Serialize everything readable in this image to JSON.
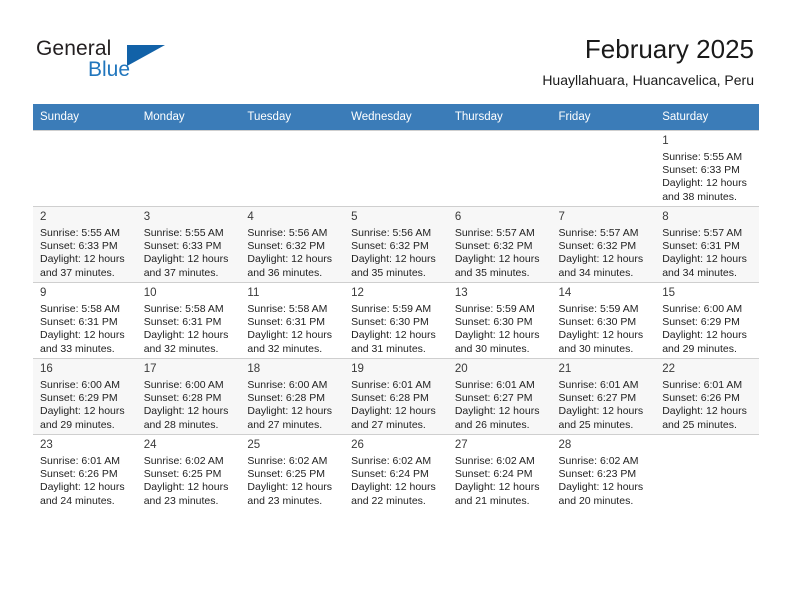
{
  "brand": {
    "word_one": "General",
    "word_two": "Blue",
    "accent_color": "#1262a8",
    "blue_text_color": "#2176bd"
  },
  "header": {
    "title": "February 2025",
    "subtitle": "Huayllahuara, Huancavelica, Peru"
  },
  "calendar": {
    "header_bg": "#3b7cb8",
    "weekday_headers": [
      "Sunday",
      "Monday",
      "Tuesday",
      "Wednesday",
      "Thursday",
      "Friday",
      "Saturday"
    ],
    "labels": {
      "sunrise": "Sunrise:",
      "sunset": "Sunset:",
      "daylight": "Daylight:"
    },
    "weeks": [
      [
        {
          "day": "",
          "sunrise": "",
          "sunset": "",
          "daylight": ""
        },
        {
          "day": "",
          "sunrise": "",
          "sunset": "",
          "daylight": ""
        },
        {
          "day": "",
          "sunrise": "",
          "sunset": "",
          "daylight": ""
        },
        {
          "day": "",
          "sunrise": "",
          "sunset": "",
          "daylight": ""
        },
        {
          "day": "",
          "sunrise": "",
          "sunset": "",
          "daylight": ""
        },
        {
          "day": "",
          "sunrise": "",
          "sunset": "",
          "daylight": ""
        },
        {
          "day": "1",
          "sunrise": "Sunrise: 5:55 AM",
          "sunset": "Sunset: 6:33 PM",
          "daylight": "Daylight: 12 hours and 38 minutes."
        }
      ],
      [
        {
          "day": "2",
          "sunrise": "Sunrise: 5:55 AM",
          "sunset": "Sunset: 6:33 PM",
          "daylight": "Daylight: 12 hours and 37 minutes."
        },
        {
          "day": "3",
          "sunrise": "Sunrise: 5:55 AM",
          "sunset": "Sunset: 6:33 PM",
          "daylight": "Daylight: 12 hours and 37 minutes."
        },
        {
          "day": "4",
          "sunrise": "Sunrise: 5:56 AM",
          "sunset": "Sunset: 6:32 PM",
          "daylight": "Daylight: 12 hours and 36 minutes."
        },
        {
          "day": "5",
          "sunrise": "Sunrise: 5:56 AM",
          "sunset": "Sunset: 6:32 PM",
          "daylight": "Daylight: 12 hours and 35 minutes."
        },
        {
          "day": "6",
          "sunrise": "Sunrise: 5:57 AM",
          "sunset": "Sunset: 6:32 PM",
          "daylight": "Daylight: 12 hours and 35 minutes."
        },
        {
          "day": "7",
          "sunrise": "Sunrise: 5:57 AM",
          "sunset": "Sunset: 6:32 PM",
          "daylight": "Daylight: 12 hours and 34 minutes."
        },
        {
          "day": "8",
          "sunrise": "Sunrise: 5:57 AM",
          "sunset": "Sunset: 6:31 PM",
          "daylight": "Daylight: 12 hours and 34 minutes."
        }
      ],
      [
        {
          "day": "9",
          "sunrise": "Sunrise: 5:58 AM",
          "sunset": "Sunset: 6:31 PM",
          "daylight": "Daylight: 12 hours and 33 minutes."
        },
        {
          "day": "10",
          "sunrise": "Sunrise: 5:58 AM",
          "sunset": "Sunset: 6:31 PM",
          "daylight": "Daylight: 12 hours and 32 minutes."
        },
        {
          "day": "11",
          "sunrise": "Sunrise: 5:58 AM",
          "sunset": "Sunset: 6:31 PM",
          "daylight": "Daylight: 12 hours and 32 minutes."
        },
        {
          "day": "12",
          "sunrise": "Sunrise: 5:59 AM",
          "sunset": "Sunset: 6:30 PM",
          "daylight": "Daylight: 12 hours and 31 minutes."
        },
        {
          "day": "13",
          "sunrise": "Sunrise: 5:59 AM",
          "sunset": "Sunset: 6:30 PM",
          "daylight": "Daylight: 12 hours and 30 minutes."
        },
        {
          "day": "14",
          "sunrise": "Sunrise: 5:59 AM",
          "sunset": "Sunset: 6:30 PM",
          "daylight": "Daylight: 12 hours and 30 minutes."
        },
        {
          "day": "15",
          "sunrise": "Sunrise: 6:00 AM",
          "sunset": "Sunset: 6:29 PM",
          "daylight": "Daylight: 12 hours and 29 minutes."
        }
      ],
      [
        {
          "day": "16",
          "sunrise": "Sunrise: 6:00 AM",
          "sunset": "Sunset: 6:29 PM",
          "daylight": "Daylight: 12 hours and 29 minutes."
        },
        {
          "day": "17",
          "sunrise": "Sunrise: 6:00 AM",
          "sunset": "Sunset: 6:28 PM",
          "daylight": "Daylight: 12 hours and 28 minutes."
        },
        {
          "day": "18",
          "sunrise": "Sunrise: 6:00 AM",
          "sunset": "Sunset: 6:28 PM",
          "daylight": "Daylight: 12 hours and 27 minutes."
        },
        {
          "day": "19",
          "sunrise": "Sunrise: 6:01 AM",
          "sunset": "Sunset: 6:28 PM",
          "daylight": "Daylight: 12 hours and 27 minutes."
        },
        {
          "day": "20",
          "sunrise": "Sunrise: 6:01 AM",
          "sunset": "Sunset: 6:27 PM",
          "daylight": "Daylight: 12 hours and 26 minutes."
        },
        {
          "day": "21",
          "sunrise": "Sunrise: 6:01 AM",
          "sunset": "Sunset: 6:27 PM",
          "daylight": "Daylight: 12 hours and 25 minutes."
        },
        {
          "day": "22",
          "sunrise": "Sunrise: 6:01 AM",
          "sunset": "Sunset: 6:26 PM",
          "daylight": "Daylight: 12 hours and 25 minutes."
        }
      ],
      [
        {
          "day": "23",
          "sunrise": "Sunrise: 6:01 AM",
          "sunset": "Sunset: 6:26 PM",
          "daylight": "Daylight: 12 hours and 24 minutes."
        },
        {
          "day": "24",
          "sunrise": "Sunrise: 6:02 AM",
          "sunset": "Sunset: 6:25 PM",
          "daylight": "Daylight: 12 hours and 23 minutes."
        },
        {
          "day": "25",
          "sunrise": "Sunrise: 6:02 AM",
          "sunset": "Sunset: 6:25 PM",
          "daylight": "Daylight: 12 hours and 23 minutes."
        },
        {
          "day": "26",
          "sunrise": "Sunrise: 6:02 AM",
          "sunset": "Sunset: 6:24 PM",
          "daylight": "Daylight: 12 hours and 22 minutes."
        },
        {
          "day": "27",
          "sunrise": "Sunrise: 6:02 AM",
          "sunset": "Sunset: 6:24 PM",
          "daylight": "Daylight: 12 hours and 21 minutes."
        },
        {
          "day": "28",
          "sunrise": "Sunrise: 6:02 AM",
          "sunset": "Sunset: 6:23 PM",
          "daylight": "Daylight: 12 hours and 20 minutes."
        },
        {
          "day": "",
          "sunrise": "",
          "sunset": "",
          "daylight": ""
        }
      ]
    ]
  }
}
